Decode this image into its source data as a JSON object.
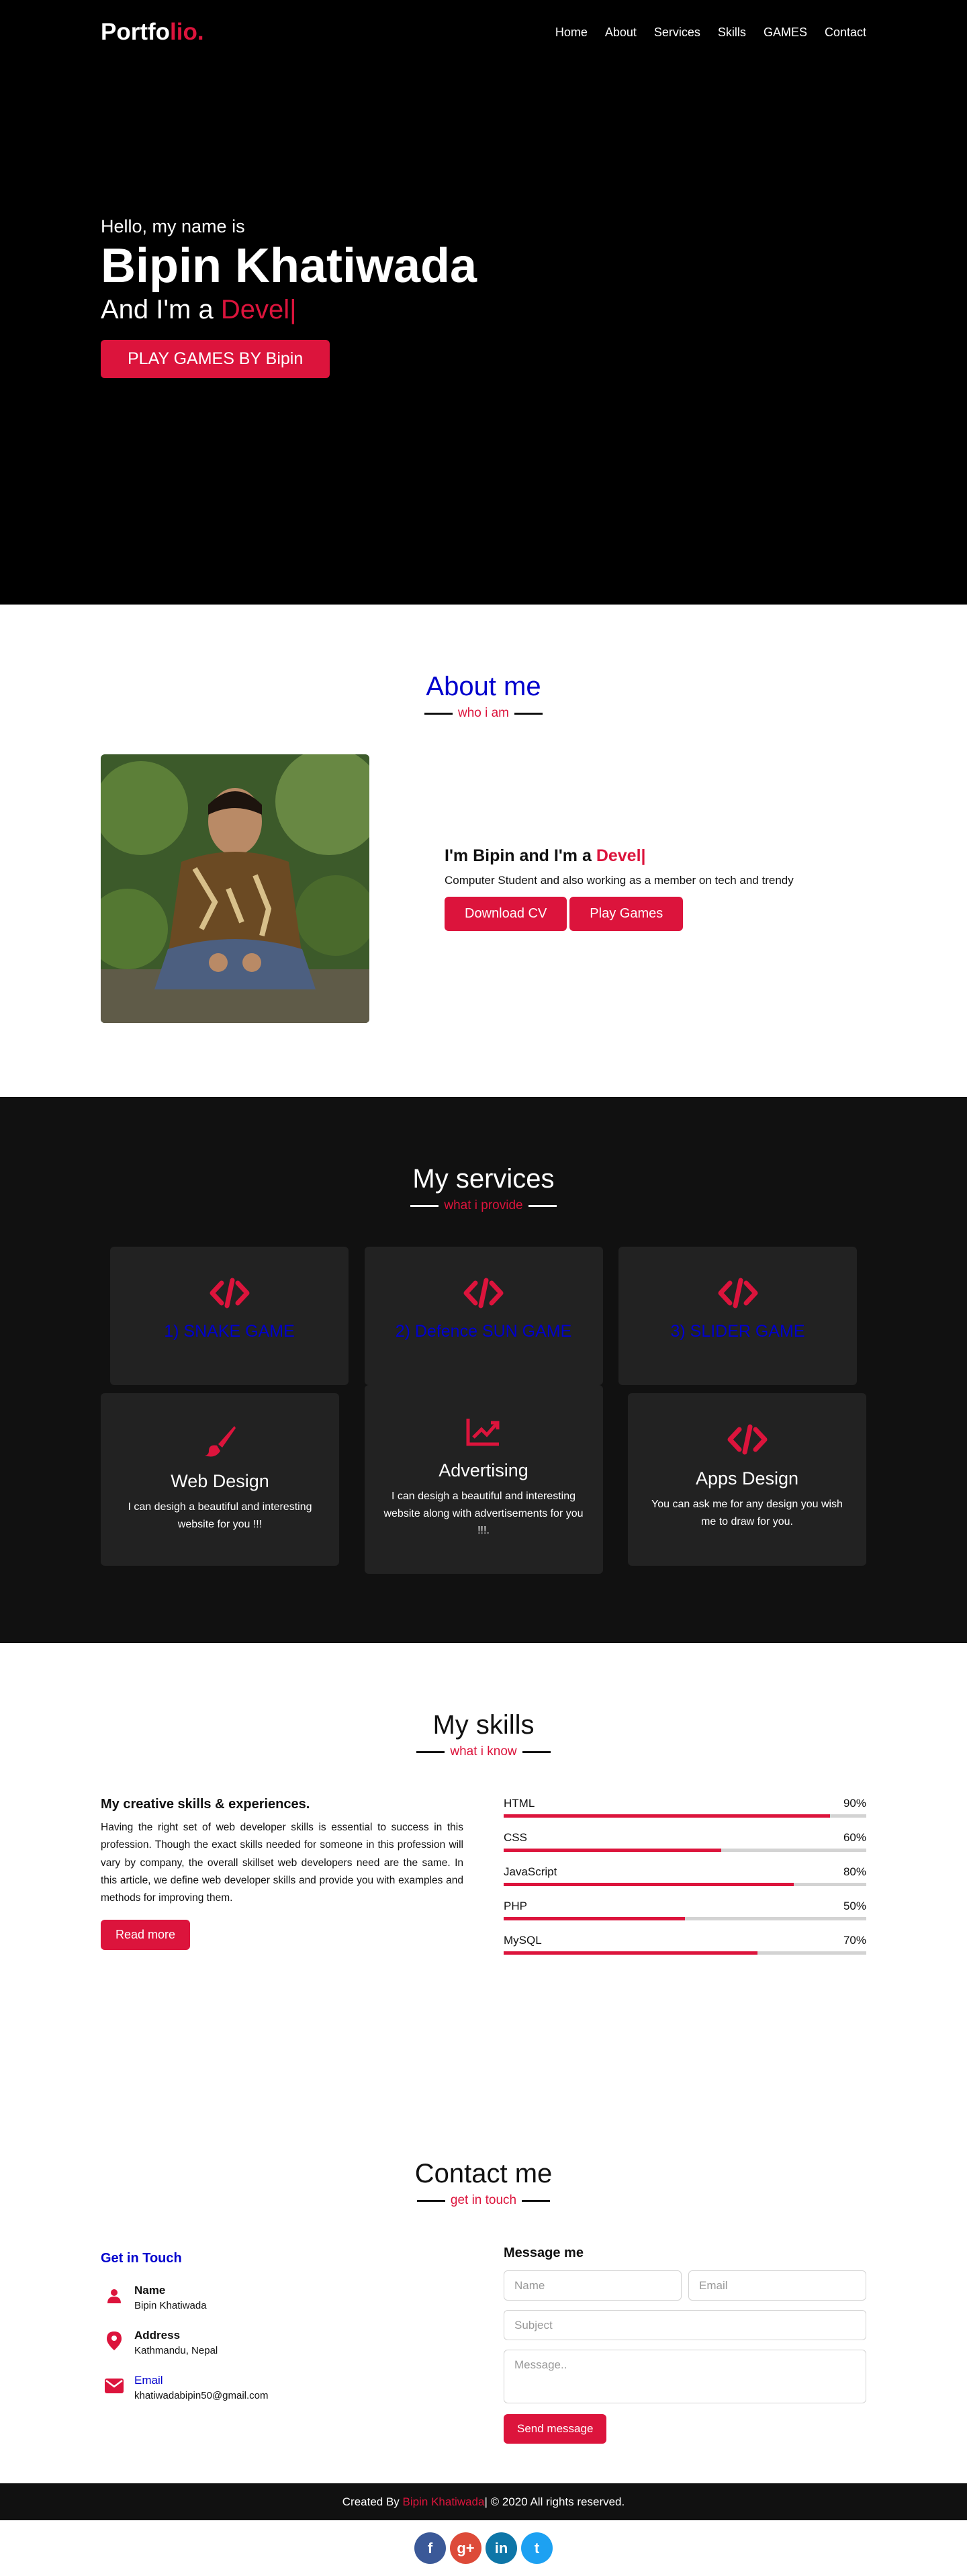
{
  "nav": {
    "logo_main": "Portfo",
    "logo_accent": "lio.",
    "items": [
      "Home",
      "About",
      "Services",
      "Skills",
      "GAMES",
      "Contact"
    ]
  },
  "hero": {
    "hello": "Hello, my name is",
    "name": "Bipin Khatiwada",
    "role_prefix": "And I'm a ",
    "role_typed": "Devel",
    "cursor": "|",
    "button": "PLAY GAMES BY Bipin"
  },
  "about": {
    "title": "About me",
    "subtitle": "who i am",
    "heading_prefix": "I'm Bipin and I'm a ",
    "heading_typed": "Devel|",
    "text": "Computer Student and also working as a member on tech and trendy",
    "btn_cv": "Download CV",
    "btn_games": "Play Games"
  },
  "services": {
    "title": "My services",
    "subtitle": "what i provide",
    "games": [
      {
        "label": "1) SNAKE GAME",
        "icon": "code-icon"
      },
      {
        "label": "2) Defence SUN GAME",
        "icon": "code-icon"
      },
      {
        "label": "3) SLIDER GAME",
        "icon": "code-icon"
      }
    ],
    "cards": [
      {
        "title": "Web Design",
        "desc": "I can desigh a beautiful and interesting website for you !!!",
        "icon": "paintbrush-icon"
      },
      {
        "title": "Advertising",
        "desc": "I can desigh a beautiful and interesting website along with advertisements for you !!!.",
        "icon": "chart-line-icon"
      },
      {
        "title": "Apps Design",
        "desc": "You can ask me for any design you wish me to draw for you.",
        "icon": "code-icon"
      }
    ]
  },
  "skills": {
    "title": "My skills",
    "subtitle": "what i know",
    "heading": "My creative skills & experiences.",
    "text": "Having the right set of web developer skills is essential to success in this profession. Though the exact skills needed for someone in this profession will vary by company, the overall skillset web developers need are the same. In this article, we define web developer skills and provide you with examples and methods for improving them.",
    "button": "Read more",
    "bars": [
      {
        "name": "HTML",
        "label": "90%",
        "value": 90
      },
      {
        "name": "CSS",
        "label": "60%",
        "value": 60
      },
      {
        "name": "JavaScript",
        "label": "80%",
        "value": 80
      },
      {
        "name": "PHP",
        "label": "50%",
        "value": 50
      },
      {
        "name": "MySQL",
        "label": "70%",
        "value": 70
      }
    ]
  },
  "contact": {
    "title": "Contact me",
    "subtitle": "get in touch",
    "get_in_touch": "Get in Touch",
    "name_head": "Name",
    "name_val": "Bipin Khatiwada",
    "address_head": "Address",
    "address_val": "Kathmandu, Nepal",
    "email_head": "Email",
    "email_val": "khatiwadabipin50@gmail.com",
    "message_head": "Message me",
    "ph_name": "Name",
    "ph_email": "Email",
    "ph_subject": "Subject",
    "ph_message": "Message..",
    "button": "Send message"
  },
  "footer": {
    "prefix": "Created By ",
    "name": "Bipin Khatiwada",
    "suffix": " | © 2020 All rights reserved."
  },
  "social": {
    "facebook": "f",
    "googleplus": "g+",
    "linkedin": "in",
    "twitter": "t",
    "colors": {
      "facebook": "#3b5998",
      "googleplus": "#dd4b39",
      "linkedin": "#0e76a8",
      "twitter": "#1da1f2"
    }
  },
  "colors": {
    "accent": "#dc143c",
    "link_blue": "#0000cd"
  }
}
